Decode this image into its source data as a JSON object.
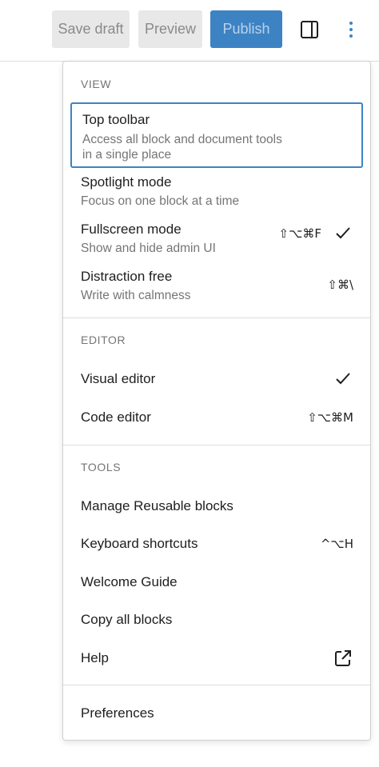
{
  "toolbar": {
    "save_draft": "Save draft",
    "preview": "Preview",
    "publish": "Publish",
    "settings_icon": "sidebar-settings-icon",
    "more_icon": "vertical-ellipsis-icon"
  },
  "menu": {
    "view": {
      "label": "VIEW",
      "items": [
        {
          "label": "Top toolbar",
          "desc_line1": "Access all block and document tools",
          "desc_line2": "in a single place"
        },
        {
          "label": "Spotlight mode",
          "desc": "Focus on one block at a time"
        },
        {
          "label": "Fullscreen mode",
          "desc": "Show and hide admin UI",
          "shortcut": "⇧⌥⌘F",
          "checked": true
        },
        {
          "label": "Distraction free",
          "desc": "Write with calmness",
          "shortcut": "⇧⌘\\"
        }
      ]
    },
    "editor": {
      "label": "EDITOR",
      "items": [
        {
          "label": "Visual editor",
          "checked": true
        },
        {
          "label": "Code editor",
          "shortcut": "⇧⌥⌘M"
        }
      ]
    },
    "tools": {
      "label": "TOOLS",
      "items": [
        {
          "label": "Manage Reusable blocks"
        },
        {
          "label": "Keyboard shortcuts",
          "shortcut": "^⌥H"
        },
        {
          "label": "Welcome Guide"
        },
        {
          "label": "Copy all blocks"
        },
        {
          "label": "Help",
          "icon": "external-link-icon"
        }
      ]
    },
    "preferences": {
      "label": "Preferences"
    }
  },
  "colors": {
    "accent": "#3d83c4",
    "muted_text": "#757575",
    "text": "#1e1e1e",
    "disabled_button_bg": "#e8e8e8"
  }
}
